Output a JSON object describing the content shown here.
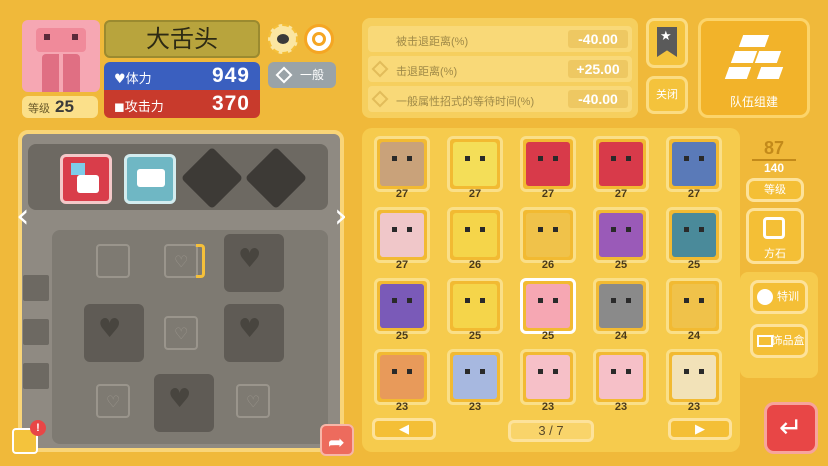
{
  "pokemon": {
    "name": "大舌头",
    "level_label": "等级",
    "level": "25",
    "hp_label": "体力",
    "hp": "949",
    "atk_label": "攻击力",
    "atk": "370",
    "type": "一般"
  },
  "bonuses": [
    {
      "label": "被击退距离(%)",
      "value": "-40.00"
    },
    {
      "label": "击退距离(%)",
      "value": "+25.00"
    },
    {
      "label": "一般属性招式的等待时间(%)",
      "value": "-40.00"
    }
  ],
  "buttons": {
    "close": "关闭",
    "team": "队伍组建",
    "level_sort": "等级",
    "stone": "方石",
    "training": "特训",
    "decor": "饰品盒"
  },
  "box": {
    "current": "87",
    "max": "140",
    "page": "3 / 7"
  },
  "list": [
    {
      "level": "27",
      "color": "#c9a27a"
    },
    {
      "level": "27",
      "color": "#f4de58"
    },
    {
      "level": "27",
      "color": "#d83a4a"
    },
    {
      "level": "27",
      "color": "#d83a4a"
    },
    {
      "level": "27",
      "color": "#5a7ab8"
    },
    {
      "level": "27",
      "color": "#f0c7c9"
    },
    {
      "level": "26",
      "color": "#f5d54a"
    },
    {
      "level": "26",
      "color": "#f0c24a"
    },
    {
      "level": "25",
      "color": "#9a5ab8"
    },
    {
      "level": "25",
      "color": "#4a8a9a"
    },
    {
      "level": "25",
      "color": "#7a5ab8"
    },
    {
      "level": "25",
      "color": "#f5d54a"
    },
    {
      "level": "25",
      "color": "#f6a7b3"
    },
    {
      "level": "24",
      "color": "#8a8a8a"
    },
    {
      "level": "24",
      "color": "#f0c24a"
    },
    {
      "level": "23",
      "color": "#e89a5a"
    },
    {
      "level": "23",
      "color": "#a7b8e0"
    },
    {
      "level": "23",
      "color": "#f6c0c8"
    },
    {
      "level": "23",
      "color": "#f6c0c8"
    },
    {
      "level": "23",
      "color": "#f2e2b8"
    }
  ],
  "colors": {
    "bg": "#f0b93a",
    "hp": "#3a5fbf",
    "atk": "#c83a2c"
  }
}
